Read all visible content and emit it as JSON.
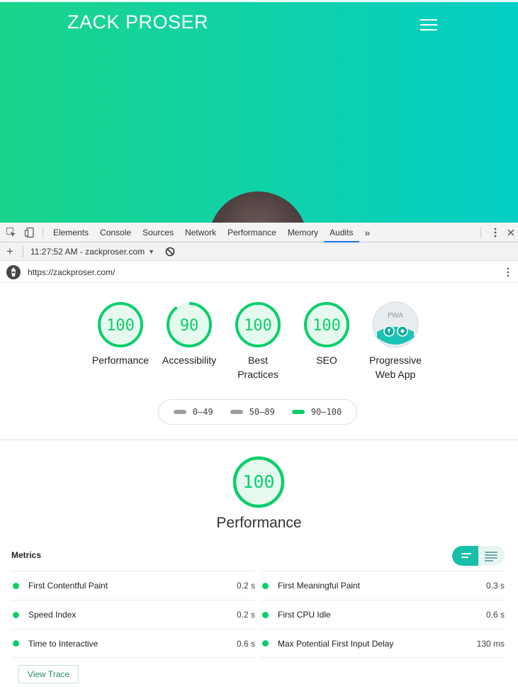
{
  "site": {
    "title": "ZACK PROSER"
  },
  "devtools": {
    "tabs": [
      "Elements",
      "Console",
      "Sources",
      "Network",
      "Performance",
      "Memory",
      "Audits"
    ],
    "active_tab": "Audits",
    "more_tabs_glyph": "»",
    "report_selector": "11:27:52 AM - zackproser.com",
    "add_label": "+",
    "url": "https://zackproser.com/"
  },
  "report": {
    "categories": [
      {
        "score": "100",
        "label_lines": [
          "Performance"
        ],
        "fraction": 1.0
      },
      {
        "score": "90",
        "label_lines": [
          "Accessibility"
        ],
        "fraction": 0.9
      },
      {
        "score": "100",
        "label_lines": [
          "Best",
          "Practices"
        ],
        "fraction": 1.0
      },
      {
        "score": "100",
        "label_lines": [
          "SEO"
        ],
        "fraction": 1.0
      }
    ],
    "pwa": {
      "label_lines": [
        "Progressive",
        "Web App"
      ],
      "badge_text": "PWA"
    },
    "legend": [
      {
        "range": "0–49",
        "color": "#9e9e9e"
      },
      {
        "range": "50–89",
        "color": "#9e9e9e"
      },
      {
        "range": "90–100",
        "color": "#0cce6b"
      }
    ],
    "performance_score": "100",
    "performance_title": "Performance",
    "metrics_title": "Metrics",
    "metrics_left": [
      {
        "name": "First Contentful Paint",
        "value": "0.2 s"
      },
      {
        "name": "Speed Index",
        "value": "0.2 s"
      },
      {
        "name": "Time to Interactive",
        "value": "0.6 s"
      }
    ],
    "metrics_right": [
      {
        "name": "First Meaningful Paint",
        "value": "0.3 s"
      },
      {
        "name": "First CPU Idle",
        "value": "0.6 s"
      },
      {
        "name": "Max Potential First Input Delay",
        "value": "130 ms"
      }
    ],
    "view_trace_label": "View Trace"
  },
  "colors": {
    "pass": "#0cce6b",
    "pass_fill": "#e6f9ef",
    "accent": "#19bfa9"
  }
}
